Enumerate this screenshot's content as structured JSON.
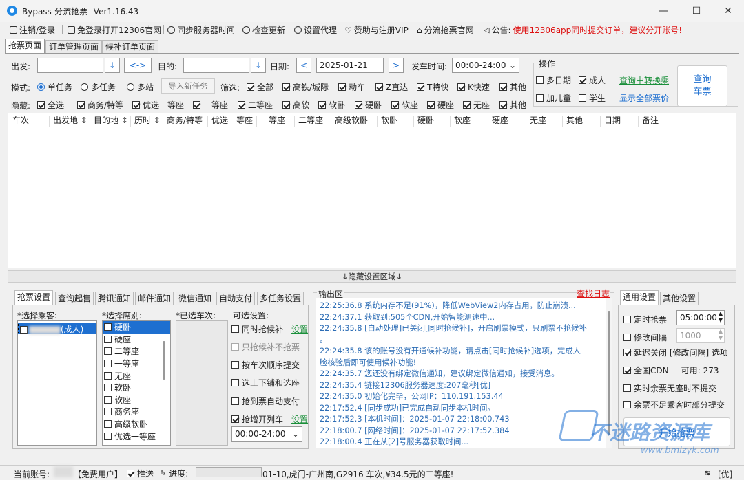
{
  "window": {
    "title": "Bypass-分流抢票--Ver1.16.43",
    "minimize": "—",
    "maximize": "☐",
    "close": "✕"
  },
  "menu": {
    "items": [
      "注销/登录",
      "免登录打开12306官网",
      "同步服务器时间",
      "检查更新",
      "设置代理",
      "赞助与注册VIP",
      "分流抢票官网"
    ],
    "notice_label": "公告:",
    "notice_text": "使用12306app同时提交订单，建议分开账号!"
  },
  "main_tabs": [
    "抢票页面",
    "订单管理页面",
    "候补订单页面"
  ],
  "form": {
    "from_label": "出发:",
    "from_value": "",
    "swap": "<->",
    "to_label": "目的:",
    "to_value": "",
    "date_label": "日期:",
    "date_value": "2025-01-21",
    "prev": "<",
    "next": ">",
    "depart_time_label": "发车时间:",
    "depart_time_value": "00:00-24:00",
    "mode_label": "模式:",
    "modes": [
      "单任务",
      "多任务",
      "多站"
    ],
    "import_task": "导入新任务",
    "filter_label": "筛选:",
    "filters": [
      "全部",
      "高铁/城际",
      "动车",
      "Z直达",
      "T特快",
      "K快速",
      "其他"
    ],
    "hide_label": "隐藏:",
    "hides": [
      "全选",
      "商务/特等",
      "优选一等座",
      "一等座",
      "二等座",
      "高软",
      "软卧",
      "硬卧",
      "软座",
      "硬座",
      "无座",
      "其他"
    ],
    "dropdown_arrow": "⌄",
    "down_arrow": "↓"
  },
  "ops": {
    "title": "操作",
    "multi_date": "多日期",
    "adult": "成人",
    "transfer_link": "查询中转换乘",
    "add_child": "加儿童",
    "student": "学生",
    "show_all_link": "显示全部票价",
    "query_button": "查询\n车票"
  },
  "table": {
    "columns": [
      "车次",
      "出发地 ↕",
      "目的地 ↕",
      "历时 ↕",
      "商务/特等",
      "优选一等座",
      "一等座",
      "二等座",
      "高级软卧",
      "软卧",
      "硬卧",
      "软座",
      "硬座",
      "无座",
      "其他",
      "日期",
      "备注"
    ]
  },
  "hide_settings_bar": "↓隐藏设置区域↓",
  "sub_tabs": [
    "抢票设置",
    "查询起售",
    "腾讯通知",
    "邮件通知",
    "微信通知",
    "自动支付",
    "多任务设置"
  ],
  "passengers": {
    "label": "*选择乘客:",
    "items": [
      "(成人)"
    ]
  },
  "seats": {
    "label": "*选择席别:",
    "items": [
      "硬卧",
      "硬座",
      "二等座",
      "一等座",
      "无座",
      "软卧",
      "软座",
      "商务座",
      "高级软卧",
      "优选一等座"
    ]
  },
  "trains": {
    "label": "*已选车次:"
  },
  "optional": {
    "label": "可选设置:",
    "items": [
      {
        "text": "同时抢候补",
        "checked": false,
        "link": "设置"
      },
      {
        "text": "只抢候补不抢票",
        "checked": false,
        "disabled": true
      },
      {
        "text": "按车次顺序提交",
        "checked": false
      },
      {
        "text": "选上下铺和选座",
        "checked": false
      },
      {
        "text": "抢到票自动支付",
        "checked": false
      },
      {
        "text": "抢增开列车",
        "checked": true,
        "link": "设置"
      }
    ],
    "time_range": "00:00-24:00"
  },
  "output": {
    "title": "输出区",
    "find_log": "查找日志",
    "lines": [
      "22:25:36.8  系统内存不足(91%)，降低WebView2内存占用，防止崩溃...",
      "22:24:37.1  获取到:505个CDN,开始智能测速中...",
      "22:24:35.8  [自动处理]已关闭[同时抢候补]，开启刷票模式，只刷票不抢候补",
      "。",
      "22:24:35.8  该的账号没有开通候补功能，请点击[同时抢候补]选项，完成人",
      "脸核验后即可使用候补功能!",
      "22:24:35.7  您还没有绑定微信通知，建议绑定微信通知，接受消息。",
      "22:24:35.4  链接12306服务器速度:207毫秒[优]",
      "22:24:35.0  初始化完毕，公网IP：110.191.153.44",
      "22:17:52.4  [同步成功]已完成自动同步本机时间。",
      "22:17:52.3  [本机时间]：2025-01-07 22:18:00.743",
      "22:18:00.7  [网络时间]：2025-01-07 22:17:52.384",
      "22:18:00.4  正在从[2]号服务器获取时间..."
    ]
  },
  "general": {
    "tabs": [
      "通用设置",
      "其他设置"
    ],
    "timed": "定时抢票",
    "timed_value": "05:00:00",
    "interval": "修改间隔",
    "interval_value": "1000",
    "delay_close": "延迟关闭 [修改间隔] 选项",
    "cdn": "全国CDN",
    "cdn_available_label": "可用:",
    "cdn_available": "273",
    "realtime": "实时余票无座时不提交",
    "partial": "余票不足乘客时部分提交",
    "start_button": "开始抢票"
  },
  "status": {
    "account_label": "当前账号:",
    "user_type": "【免费用户】",
    "push": "推送",
    "progress_label": "进度:",
    "message": "01-10,虎门-广州南,G2916 车次,¥34.5元的二等座!",
    "network": "[优]"
  },
  "watermark": {
    "text": "不迷路资源库",
    "url": "www.bmlzyk.com"
  }
}
